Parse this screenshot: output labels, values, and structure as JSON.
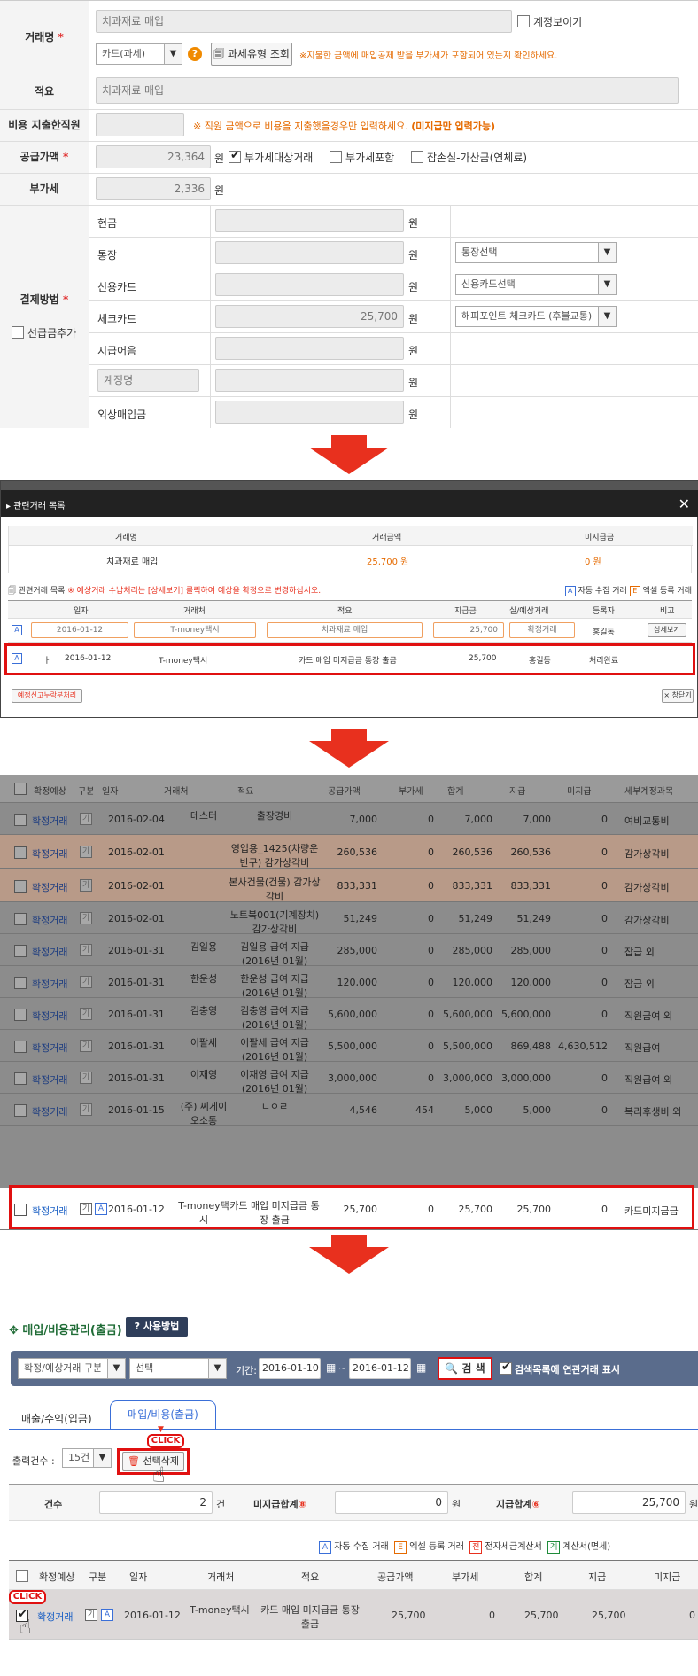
{
  "form": {
    "vendor_label": "거래명",
    "vendor_value": "치과재료 매입",
    "show_account": "계정보이기",
    "tax_type": "카드(과세)",
    "tax_lookup": "과세유형 조회",
    "tax_notice": "※지불한 금액에 매입공제 받을 부가세가 포함되어 있는지 확인하세요.",
    "memo_label": "적요",
    "memo_value": "치과재료 매입",
    "staff_label": "비용 지출한직원",
    "staff_notice": "※ 직원 금액으로 비용을 지출했을경우만 입력하세요.",
    "staff_notice_bold": "(미지급만 입력가능)",
    "supply_label": "공급가액",
    "supply_value": "23,364",
    "won": "원",
    "vat_target": "부가세대상거래",
    "vat_incl": "부가세포함",
    "misc_loss": "잡손실-가산금(연체료)",
    "vat_label": "부가세",
    "vat_value": "2,336",
    "pay_label": "결제방법",
    "prepay": "선급금추가",
    "rows": [
      {
        "label": "현금",
        "amount": "",
        "select": ""
      },
      {
        "label": "통장",
        "amount": "",
        "select": "통장선택"
      },
      {
        "label": "신용카드",
        "amount": "",
        "select": "신용카드선택"
      },
      {
        "label": "체크카드",
        "amount": "25,700",
        "select": "해피포인트 체크카드 (후불교통)"
      },
      {
        "label": "지급어음",
        "amount": "",
        "select": ""
      },
      {
        "label": "",
        "amount": "",
        "select": ""
      },
      {
        "label": "외상매입금",
        "amount": "",
        "select": ""
      }
    ],
    "account_placeholder": "계정명"
  },
  "modal": {
    "title": "관련거래 목록",
    "close": "✕",
    "summary_headers": [
      "거래명",
      "거래금액",
      "미지급금"
    ],
    "summary_values": [
      "치과재료 매입",
      "25,700 원",
      "0 원"
    ],
    "list_title": "관련거래 목록",
    "list_notice": "※ 예상거래 수납처리는 [상세보기] 클릭하여 예상을 확정으로 변경하십시오.",
    "legend_auto": "자동 수집 거래",
    "legend_excel": "엑셀 등록 거래",
    "headers": [
      "일자",
      "거래처",
      "적요",
      "지급금",
      "실/예상거래",
      "등록자",
      "비고"
    ],
    "row1": {
      "date": "2016-01-12",
      "vendor": "T-money택시",
      "memo": "치과재료 매입",
      "amount": "25,700",
      "status": "확정거래",
      "user": "홍길동",
      "btn": "상세보기"
    },
    "row2": {
      "date": "2016-01-12",
      "vendor": "T-money택시",
      "memo": "카드 매입 미지급금 통장 출금",
      "amount": "25,700",
      "status": "홍길동",
      "user": "처리완료"
    },
    "btn_left": "예정신고누락분처리",
    "btn_right": "창닫기"
  },
  "grid": {
    "headers": [
      "확정예상",
      "구분",
      "일자",
      "거래처",
      "적요",
      "공급가액",
      "부가세",
      "합계",
      "지급",
      "미지급",
      "세부계정과목"
    ],
    "rows": [
      {
        "status": "확정거래",
        "date": "2016-02-04",
        "vendor": "테스터",
        "memo": "출장경비",
        "supply": "7,000",
        "vat": "0",
        "total": "7,000",
        "paid": "7,000",
        "unpaid": "0",
        "account": "여비교통비"
      },
      {
        "status": "확정거래",
        "date": "2016-02-01",
        "vendor": "",
        "memo": "영업용_1425(차량운반구) 감가상각비",
        "supply": "260,536",
        "vat": "0",
        "total": "260,536",
        "paid": "260,536",
        "unpaid": "0",
        "account": "감가상각비"
      },
      {
        "status": "확정거래",
        "date": "2016-02-01",
        "vendor": "",
        "memo": "본사건물(건물) 감가상각비",
        "supply": "833,331",
        "vat": "0",
        "total": "833,331",
        "paid": "833,331",
        "unpaid": "0",
        "account": "감가상각비"
      },
      {
        "status": "확정거래",
        "date": "2016-02-01",
        "vendor": "",
        "memo": "노트북001(기계장치) 감가상각비",
        "supply": "51,249",
        "vat": "0",
        "total": "51,249",
        "paid": "51,249",
        "unpaid": "0",
        "account": "감가상각비"
      },
      {
        "status": "확정거래",
        "date": "2016-01-31",
        "vendor": "김일용",
        "memo": "김일용 급여 지급(2016년 01월)",
        "supply": "285,000",
        "vat": "0",
        "total": "285,000",
        "paid": "285,000",
        "unpaid": "0",
        "account": "잡급 외"
      },
      {
        "status": "확정거래",
        "date": "2016-01-31",
        "vendor": "한운성",
        "memo": "한운성 급여 지급(2016년 01월)",
        "supply": "120,000",
        "vat": "0",
        "total": "120,000",
        "paid": "120,000",
        "unpaid": "0",
        "account": "잡급 외"
      },
      {
        "status": "확정거래",
        "date": "2016-01-31",
        "vendor": "김충영",
        "memo": "김충영 급여 지급(2016년 01월)",
        "supply": "5,600,000",
        "vat": "0",
        "total": "5,600,000",
        "paid": "5,600,000",
        "unpaid": "0",
        "account": "직원급여 외"
      },
      {
        "status": "확정거래",
        "date": "2016-01-31",
        "vendor": "이팔세",
        "memo": "이팔세 급여 지급(2016년 01월)",
        "supply": "5,500,000",
        "vat": "0",
        "total": "5,500,000",
        "paid": "869,488",
        "unpaid": "4,630,512",
        "account": "직원급여"
      },
      {
        "status": "확정거래",
        "date": "2016-01-31",
        "vendor": "이재영",
        "memo": "이재영 급여 지급(2016년 01월)",
        "supply": "3,000,000",
        "vat": "0",
        "total": "3,000,000",
        "paid": "3,000,000",
        "unpaid": "0",
        "account": "직원급여 외"
      },
      {
        "status": "확정거래",
        "date": "2016-01-15",
        "vendor": "(주) 씨게이오소통",
        "memo": "ㄴㅇㄹ",
        "supply": "4,546",
        "vat": "454",
        "total": "5,000",
        "paid": "5,000",
        "unpaid": "0",
        "account": "복리후생비 외"
      },
      {
        "status": "확정거래",
        "date": "2016-01-12",
        "vendor": "T-money택시",
        "memo": "카드 매입 미지급금 통장 출금",
        "supply": "25,700",
        "vat": "0",
        "total": "25,700",
        "paid": "25,700",
        "unpaid": "0",
        "account": "카드미지급금"
      }
    ]
  },
  "page": {
    "title": "매입/비용관리(출금)",
    "howto": "사용방법",
    "filter_type": "확정/예상거래 구분",
    "filter_sel": "선택",
    "period": "기간:",
    "date_from": "2016-01-10",
    "tilde": "~",
    "date_to": "2016-01-12",
    "search": "검 색",
    "show_related": "검색목록에 연관거래 표시",
    "tab1": "매출/수익(입금)",
    "tab2": "매입/비용(출금)",
    "count_label": "출력건수 :",
    "count_value": "15건",
    "delete_btn": "선택삭제",
    "click": "CLICK",
    "sum_count_label": "건수",
    "sum_count": "2",
    "unit_count": "건",
    "sum_unpaid_label": "미지급합계",
    "sum_unpaid": "0",
    "sum_paid_label": "지급합계",
    "sum_paid": "25,700",
    "won": "원",
    "legend": [
      "자동 수집 거래",
      "엑셀 등록 거래",
      "전자세금계산서",
      "계산서(면세)"
    ],
    "headers": [
      "확정예상",
      "구분",
      "일자",
      "거래처",
      "적요",
      "공급가액",
      "부가세",
      "합계",
      "지급",
      "미지급"
    ],
    "row": {
      "status": "확정거래",
      "date": "2016-01-12",
      "vendor": "T-money택시",
      "memo": "카드 매입 미지급금 통장 출금",
      "supply": "25,700",
      "vat": "0",
      "total": "25,700",
      "paid": "25,700",
      "unpaid": "0"
    }
  },
  "colors": {
    "accent": "#e8301e",
    "blue": "#1a5fc4",
    "orange": "#e56a00"
  }
}
